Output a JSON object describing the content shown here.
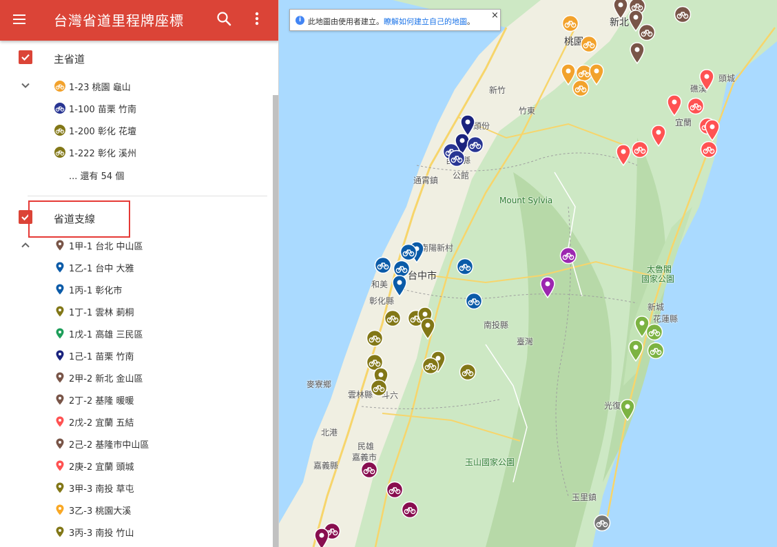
{
  "header": {
    "title": "台灣省道里程牌座標"
  },
  "layers": [
    {
      "title": "主省道",
      "items": [
        {
          "label": "1-23 桃園 龜山",
          "color": "#f2a22c",
          "icon": "bike-circle-icon"
        },
        {
          "label": "1-100 苗栗 竹南",
          "color": "#283593",
          "icon": "bike-circle-icon"
        },
        {
          "label": "1-200 彰化 花壇",
          "color": "#827717",
          "icon": "bike-circle-icon"
        },
        {
          "label": "1-222 彰化 溪州",
          "color": "#827717",
          "icon": "bike-circle-icon"
        }
      ],
      "more_label": "... 還有 54 個"
    },
    {
      "title": "省道支線",
      "items": [
        {
          "label": "1甲-1 台北 中山區",
          "color": "#795548",
          "icon": "pin-icon"
        },
        {
          "label": "1乙-1 台中 大雅",
          "color": "#0b5ba8",
          "icon": "pin-icon"
        },
        {
          "label": "1丙-1 彰化市",
          "color": "#0b5ba8",
          "icon": "pin-icon"
        },
        {
          "label": "1丁-1 雲林 莿桐",
          "color": "#827717",
          "icon": "pin-icon"
        },
        {
          "label": "1戊-1 高雄 三民區",
          "color": "#1e9e5a",
          "icon": "pin-icon"
        },
        {
          "label": "1己-1 苗栗 竹南",
          "color": "#1a237e",
          "icon": "pin-icon"
        },
        {
          "label": "2甲-2 新北 金山區",
          "color": "#795548",
          "icon": "pin-icon"
        },
        {
          "label": "2丁-2 基隆 暖暖",
          "color": "#795548",
          "icon": "pin-icon"
        },
        {
          "label": "2戊-2 宜蘭 五結",
          "color": "#ff5252",
          "icon": "pin-icon"
        },
        {
          "label": "2己-2 基隆市中山區",
          "color": "#795548",
          "icon": "pin-icon"
        },
        {
          "label": "2庚-2 宜蘭 頭城",
          "color": "#ff5252",
          "icon": "pin-icon"
        },
        {
          "label": "3甲-3 南投 草屯",
          "color": "#827717",
          "icon": "pin-icon"
        },
        {
          "label": "3乙-3 桃園大溪",
          "color": "#f9a825",
          "icon": "pin-icon"
        },
        {
          "label": "3丙-3 南投 竹山",
          "color": "#827717",
          "icon": "pin-icon"
        }
      ]
    }
  ],
  "map": {
    "notice_text": "此地圖由使用者建立。",
    "notice_link": "瞭解如何建立自己的地圖",
    "notice_end": "。",
    "close_label": "×",
    "places": [
      {
        "name": "新北",
        "cls": "big"
      },
      {
        "name": "桃園",
        "cls": "big"
      },
      {
        "name": "新竹",
        "cls": ""
      },
      {
        "name": "竹東",
        "cls": ""
      },
      {
        "name": "頭份",
        "cls": ""
      },
      {
        "name": "苗栗縣",
        "cls": ""
      },
      {
        "name": "公館",
        "cls": ""
      },
      {
        "name": "通霄鎮",
        "cls": ""
      },
      {
        "name": "Mount Sylvia",
        "cls": "park"
      },
      {
        "name": "南陽新村",
        "cls": ""
      },
      {
        "name": "台中市",
        "cls": "big"
      },
      {
        "name": "和美",
        "cls": ""
      },
      {
        "name": "彰化縣",
        "cls": ""
      },
      {
        "name": "南投縣",
        "cls": ""
      },
      {
        "name": "臺灣",
        "cls": ""
      },
      {
        "name": "麥寮鄉",
        "cls": ""
      },
      {
        "name": "雲林縣",
        "cls": ""
      },
      {
        "name": "斗六",
        "cls": ""
      },
      {
        "name": "北港",
        "cls": ""
      },
      {
        "name": "民雄",
        "cls": ""
      },
      {
        "name": "嘉義市",
        "cls": ""
      },
      {
        "name": "嘉義縣",
        "cls": ""
      },
      {
        "name": "玉山國家公園",
        "cls": "park"
      },
      {
        "name": "礁溪",
        "cls": ""
      },
      {
        "name": "頭城",
        "cls": ""
      },
      {
        "name": "宜蘭",
        "cls": ""
      },
      {
        "name": "太魯閣",
        "cls": "park"
      },
      {
        "name": "國家公園",
        "cls": "park"
      },
      {
        "name": "新城",
        "cls": ""
      },
      {
        "name": "花蓮縣",
        "cls": ""
      },
      {
        "name": "光復",
        "cls": ""
      },
      {
        "name": "玉里鎮",
        "cls": ""
      }
    ],
    "markers": [
      {
        "color": "#795548",
        "type": "pin"
      },
      {
        "color": "#795548",
        "type": "bike"
      },
      {
        "color": "#795548",
        "type": "bike"
      },
      {
        "color": "#795548",
        "type": "bike"
      },
      {
        "color": "#795548",
        "type": "pin"
      },
      {
        "color": "#795548",
        "type": "pin"
      },
      {
        "color": "#f2a22c",
        "type": "bike"
      },
      {
        "color": "#f2a22c",
        "type": "bike"
      },
      {
        "color": "#f2a22c",
        "type": "pin"
      },
      {
        "color": "#f2a22c",
        "type": "bike"
      },
      {
        "color": "#f2a22c",
        "type": "pin"
      },
      {
        "color": "#f2a22c",
        "type": "bike"
      },
      {
        "color": "#ff5252",
        "type": "pin"
      },
      {
        "color": "#ff5252",
        "type": "pin"
      },
      {
        "color": "#ff5252",
        "type": "bike"
      },
      {
        "color": "#ff5252",
        "type": "bike"
      },
      {
        "color": "#ff5252",
        "type": "pin"
      },
      {
        "color": "#ff5252",
        "type": "pin"
      },
      {
        "color": "#ff5252",
        "type": "bike"
      },
      {
        "color": "#ff5252",
        "type": "pin"
      },
      {
        "color": "#ff5252",
        "type": "bike"
      },
      {
        "color": "#1a237e",
        "type": "pin"
      },
      {
        "color": "#1a237e",
        "type": "pin"
      },
      {
        "color": "#283593",
        "type": "bike"
      },
      {
        "color": "#283593",
        "type": "bike"
      },
      {
        "color": "#283593",
        "type": "bike"
      },
      {
        "color": "#0b5ba8",
        "type": "pin"
      },
      {
        "color": "#0b5ba8",
        "type": "bike"
      },
      {
        "color": "#0b5ba8",
        "type": "bike"
      },
      {
        "color": "#0b5ba8",
        "type": "bike"
      },
      {
        "color": "#0b5ba8",
        "type": "pin"
      },
      {
        "color": "#0b5ba8",
        "type": "bike"
      },
      {
        "color": "#0b5ba8",
        "type": "bike"
      },
      {
        "color": "#9c27b0",
        "type": "bike"
      },
      {
        "color": "#9c27b0",
        "type": "pin"
      },
      {
        "color": "#827717",
        "type": "bike"
      },
      {
        "color": "#827717",
        "type": "bike"
      },
      {
        "color": "#827717",
        "type": "pin"
      },
      {
        "color": "#827717",
        "type": "pin"
      },
      {
        "color": "#827717",
        "type": "bike"
      },
      {
        "color": "#827717",
        "type": "bike"
      },
      {
        "color": "#827717",
        "type": "pin"
      },
      {
        "color": "#827717",
        "type": "bike"
      },
      {
        "color": "#827717",
        "type": "pin"
      },
      {
        "color": "#827717",
        "type": "bike"
      },
      {
        "color": "#827717",
        "type": "bike"
      },
      {
        "color": "#7cb342",
        "type": "pin"
      },
      {
        "color": "#7cb342",
        "type": "bike"
      },
      {
        "color": "#7cb342",
        "type": "pin"
      },
      {
        "color": "#7cb342",
        "type": "bike"
      },
      {
        "color": "#7cb342",
        "type": "pin"
      },
      {
        "color": "#880e4f",
        "type": "bike"
      },
      {
        "color": "#880e4f",
        "type": "bike"
      },
      {
        "color": "#880e4f",
        "type": "bike"
      },
      {
        "color": "#880e4f",
        "type": "bike"
      },
      {
        "color": "#880e4f",
        "type": "pin"
      },
      {
        "color": "#757575",
        "type": "bike"
      }
    ]
  }
}
